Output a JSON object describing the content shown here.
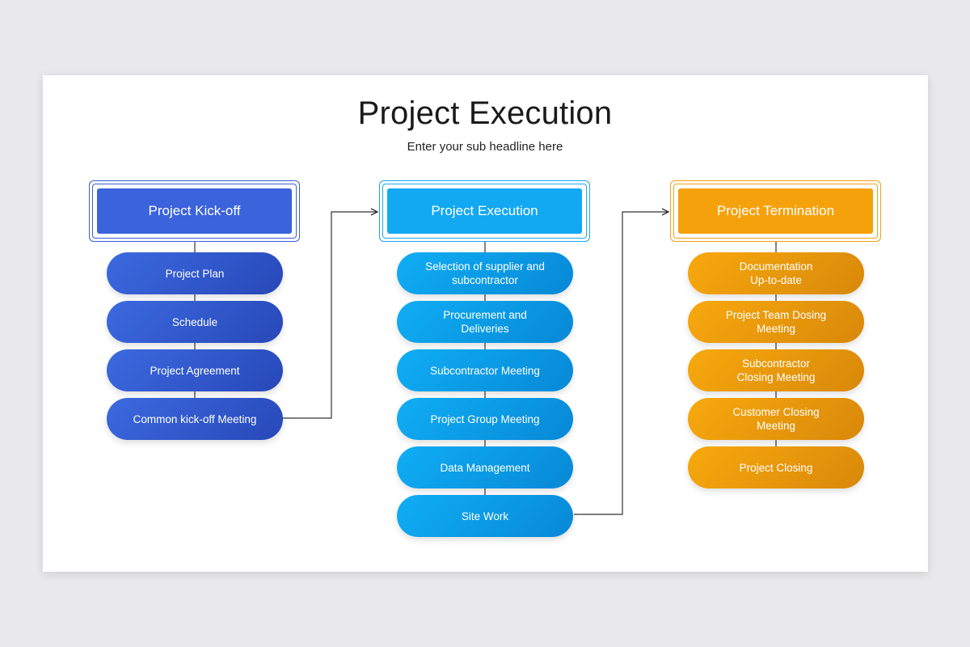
{
  "title": "Project Execution",
  "subtitle": "Enter your sub headline here",
  "colors": {
    "blue": "#3a63dc",
    "sky": "#13a8f2",
    "orange": "#f5a10c",
    "connector": "#333333"
  },
  "columns": [
    {
      "header": "Project Kick-off",
      "items": [
        "Project Plan",
        "Schedule",
        "Project Agreement",
        "Common kick-off Meeting"
      ]
    },
    {
      "header": "Project Execution",
      "items": [
        "Selection of supplier and\nsubcontractor",
        "Procurement  and\nDeliveries",
        "Subcontractor  Meeting",
        "Project Group Meeting",
        "Data Management",
        "Site Work"
      ]
    },
    {
      "header": "Project Termination",
      "items": [
        "Documentation\nUp-to-date",
        "Project Team Dosing\nMeeting",
        "Subcontractor\nClosing Meeting",
        "Customer Closing\nMeeting",
        "Project Closing"
      ]
    }
  ]
}
